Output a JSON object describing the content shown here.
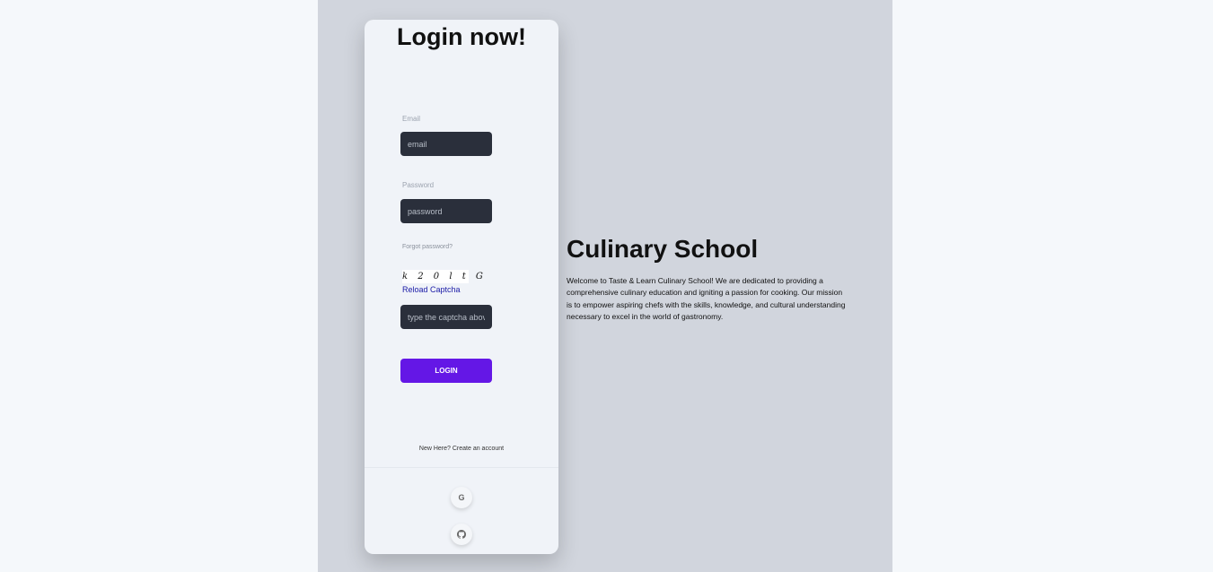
{
  "login": {
    "title": "Login now!",
    "email_label": "Email",
    "email_placeholder": "email",
    "password_label": "Password",
    "password_placeholder": "password",
    "forgot_password": "Forgot password?",
    "captcha_text": "k 2 0 l t G",
    "reload_captcha": "Reload Captcha",
    "captcha_placeholder": "type the captcha above",
    "login_button": "LOGIN",
    "signup_link": "New Here? Create an account",
    "social": [
      {
        "name": "google-icon",
        "glyph": "G"
      },
      {
        "name": "github-icon",
        "glyph": ""
      }
    ]
  },
  "info": {
    "title": "Culinary School",
    "description": "Welcome to Taste & Learn Culinary School! We are dedicated to providing a comprehensive culinary education and igniting a passion for cooking. Our mission is to empower aspiring chefs with the skills, knowledge, and cultural understanding necessary to excel in the world of gastronomy."
  },
  "colors": {
    "background": "#f5f8fb",
    "stage": "#d1d5dd",
    "card": "#f0f3f8",
    "input": "#2a2f3b",
    "accent": "#6417e6",
    "link": "#1a1aa6"
  }
}
